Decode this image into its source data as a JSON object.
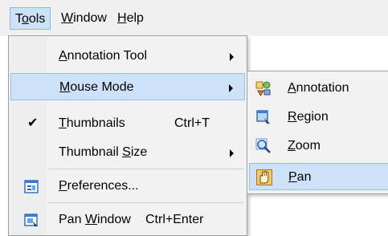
{
  "menubar": {
    "items": [
      {
        "pre": "T",
        "key": "o",
        "post": "ols"
      },
      {
        "pre": "",
        "key": "W",
        "post": "indow"
      },
      {
        "pre": "",
        "key": "H",
        "post": "elp"
      }
    ]
  },
  "tools_menu": {
    "annotation_tool": {
      "pre": "",
      "key": "A",
      "post": "nnotation Tool"
    },
    "mouse_mode": {
      "pre": "",
      "key": "M",
      "post": "ouse Mode"
    },
    "thumbnails": {
      "pre": "",
      "key": "T",
      "post": "humbnails",
      "shortcut": "Ctrl+T",
      "checked": "✔"
    },
    "thumbnail_size": {
      "pre": "Thumbnail ",
      "key": "S",
      "post": "ize"
    },
    "preferences": {
      "pre": "",
      "key": "P",
      "post": "references..."
    },
    "pan_window": {
      "pre": "Pan ",
      "key": "W",
      "post": "indow",
      "shortcut": "Ctrl+Enter"
    }
  },
  "mouse_mode_submenu": {
    "items": [
      {
        "pre": "",
        "key": "A",
        "post": "nnotation",
        "icon": "annotation-icon"
      },
      {
        "pre": "",
        "key": "R",
        "post": "egion",
        "icon": "region-icon"
      },
      {
        "pre": "",
        "key": "Z",
        "post": "oom",
        "icon": "zoom-icon"
      },
      {
        "pre": "",
        "key": "P",
        "post": "an",
        "icon": "pan-hand-icon"
      }
    ]
  },
  "colors": {
    "highlight": "#cde1f9",
    "highlight_border": "#99bde7",
    "menu_bg": "#f2f2f2"
  }
}
